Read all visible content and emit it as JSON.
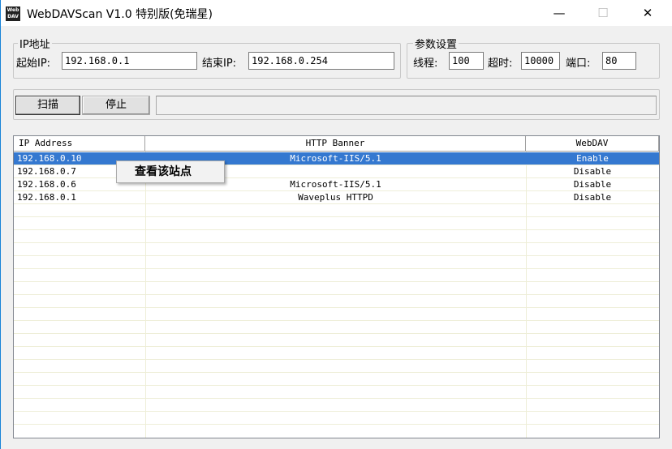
{
  "window": {
    "title": "WebDAVScan V1.0 特别版(免瑞星)",
    "logo_text": "Web DAV",
    "minimize": "—",
    "maximize": "☐",
    "close": "✕"
  },
  "ip_group": {
    "legend": "IP地址",
    "start_label": "起始IP:",
    "start_value": "192.168.0.1",
    "end_label": "结束IP:",
    "end_value": "192.168.0.254"
  },
  "param_group": {
    "legend": "参数设置",
    "threads_label": "线程:",
    "threads_value": "100",
    "timeout_label": "超时:",
    "timeout_value": "10000",
    "port_label": "端口:",
    "port_value": "80"
  },
  "buttons": {
    "scan": "扫描",
    "stop": "停止"
  },
  "progress": 0,
  "table": {
    "columns": [
      "IP Address",
      "HTTP Banner",
      "WebDAV"
    ],
    "rows": [
      {
        "ip": "192.168.0.10",
        "banner": "Microsoft-IIS/5.1",
        "webdav": "Enable"
      },
      {
        "ip": "192.168.0.7",
        "banner": "",
        "webdav": "Disable"
      },
      {
        "ip": "192.168.0.6",
        "banner": "Microsoft-IIS/5.1",
        "webdav": "Disable"
      },
      {
        "ip": "192.168.0.1",
        "banner": "Waveplus HTTPD",
        "webdav": "Disable"
      }
    ]
  },
  "context_menu": {
    "items": [
      "查看该站点"
    ]
  }
}
